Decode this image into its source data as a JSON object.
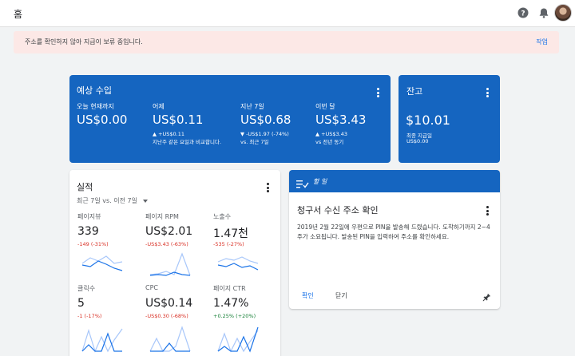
{
  "header": {
    "title": "홈",
    "icons": [
      "help-icon",
      "bell-icon",
      "avatar"
    ]
  },
  "alert": {
    "message": "주소를 확인하지 않아 지급이 보류 중입니다.",
    "action": "작업"
  },
  "estimated": {
    "title": "예상 수입",
    "columns": [
      {
        "label": "오늘 현재까지",
        "value": "US$0.00",
        "sub1": "",
        "sub2": ""
      },
      {
        "label": "어제",
        "value": "US$0.11",
        "sub1": "▲ +US$0.11",
        "sub2": "지난주 같은 요일과 비교합니다."
      },
      {
        "label": "지난 7일",
        "value": "US$0.68",
        "sub1": "▼ -US$1.97 (-74%)",
        "sub2": "vs. 최근 7일"
      },
      {
        "label": "이번 달",
        "value": "US$3.43",
        "sub1": "▲ +US$3.43",
        "sub2": "vs 전년 동기"
      }
    ]
  },
  "balance": {
    "title": "잔고",
    "value": "$10.01",
    "sub_label": "최종 지급일",
    "sub_value": "US$0.00"
  },
  "performance": {
    "title": "실적",
    "range": "최근 7일 vs. 이전 7일",
    "metrics": [
      {
        "label": "페이지뷰",
        "value": "339",
        "change": "-149 (-31%)",
        "trend": "neg"
      },
      {
        "label": "페이지 RPM",
        "value": "US$2.01",
        "change": "-US$3.43 (-63%)",
        "trend": "neg"
      },
      {
        "label": "노출수",
        "value": "1.47천",
        "change": "-535 (-27%)",
        "trend": "neg"
      },
      {
        "label": "클릭수",
        "value": "5",
        "change": "-1 (-17%)",
        "trend": "neg"
      },
      {
        "label": "CPC",
        "value": "US$0.14",
        "change": "-US$0.30 (-68%)",
        "trend": "neg"
      },
      {
        "label": "페이지 CTR",
        "value": "1.47%",
        "change": "+0.25% (+20%)",
        "trend": "pos"
      }
    ]
  },
  "todo": {
    "header": "할 일",
    "title": "청구서 수신 주소 확인",
    "body": "2019년 2월 22일에 우편으로 PIN을 발송해 드렸습니다. 도착하기까지 2~4주가 소요됩니다. 발송된 PIN을 입력하여 주소를 확인하세요.",
    "confirm": "확인",
    "close": "닫기"
  },
  "colors": {
    "primary": "#1565c0",
    "accent": "#1a73e8",
    "alert_bg": "#fce8e6",
    "negative": "#d93025",
    "positive": "#188038"
  }
}
